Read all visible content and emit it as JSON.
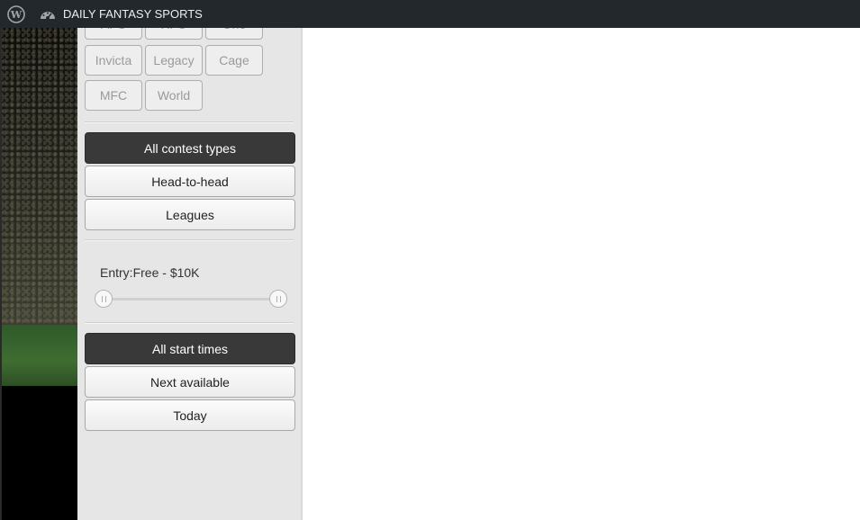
{
  "adminbar": {
    "site_name": "DAILY FANTASY SPORTS",
    "wp_logo_icon": "wordpress-logo-icon",
    "dashboard_icon": "dashboard-gauge-icon"
  },
  "leagues": {
    "row0": [
      "AFC",
      "XFC",
      "One"
    ],
    "row1": [
      "Invicta",
      "Legacy",
      "Cage"
    ],
    "row2": [
      "MFC",
      "World"
    ]
  },
  "contest_types": {
    "all": "All contest types",
    "h2h": "Head-to-head",
    "leagues": "Leagues"
  },
  "entry": {
    "label": "Entry:",
    "min": "Free",
    "separator": " - ",
    "max": "$10K",
    "range_fraction": [
      0,
      1
    ]
  },
  "start_times": {
    "all": "All start times",
    "next": "Next available",
    "today": "Today"
  },
  "colors": {
    "adminbar": "#23282d",
    "panel": "#e6e6e6",
    "active_button": "#393939"
  }
}
